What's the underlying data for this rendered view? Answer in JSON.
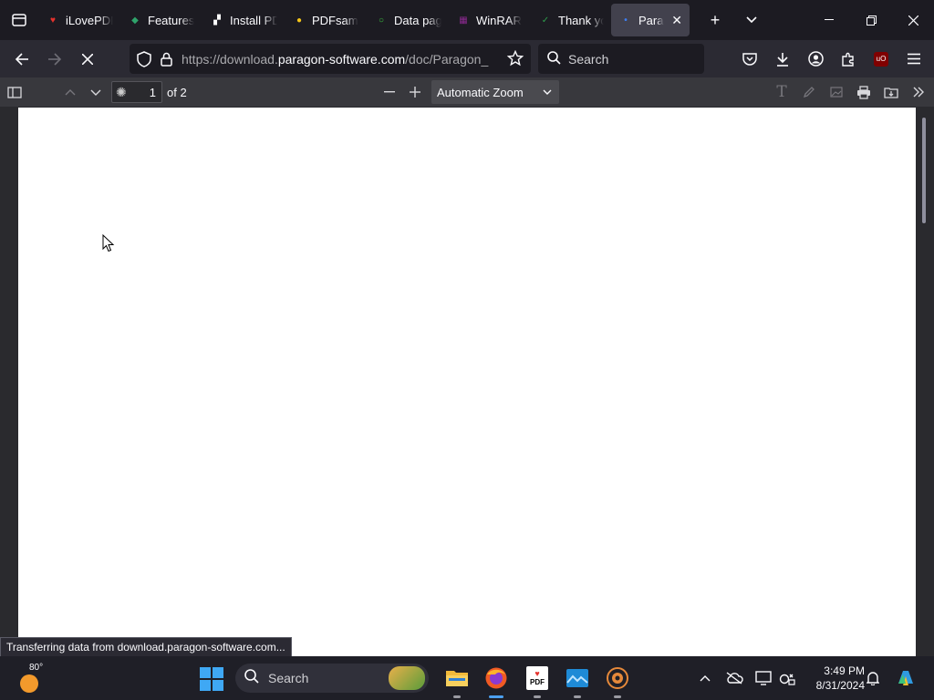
{
  "browser": {
    "tabs": [
      {
        "label": "iLovePDF",
        "favicon_color": "#e5322d",
        "favicon_glyph": "♥",
        "active": false
      },
      {
        "label": "Features",
        "favicon_color": "#2fa36b",
        "favicon_glyph": "◆",
        "active": false
      },
      {
        "label": "Install PDF",
        "favicon_color": "#ffffff",
        "favicon_glyph": "▞",
        "active": false
      },
      {
        "label": "PDFsam",
        "favicon_color": "#f5c518",
        "favicon_glyph": "●",
        "active": false
      },
      {
        "label": "Data page",
        "favicon_color": "#3cc441",
        "favicon_glyph": "○",
        "active": false
      },
      {
        "label": "WinRAR",
        "favicon_color": "#8b2a8f",
        "favicon_glyph": "▦",
        "active": false
      },
      {
        "label": "Thank you",
        "favicon_color": "#2e9d4b",
        "favicon_glyph": "✓",
        "active": false
      },
      {
        "label": "Parag",
        "favicon_color": "#3d7ef0",
        "favicon_glyph": "•",
        "active": true
      }
    ],
    "url_prefix": "https://download.",
    "url_domain": "paragon-software.com",
    "url_path": "/doc/Paragon_",
    "search_placeholder": "Search"
  },
  "pdf_toolbar": {
    "page_number": "1",
    "page_count": "of 2",
    "zoom": "Automatic Zoom"
  },
  "status": {
    "text": "Transferring data from download.paragon-software.com..."
  },
  "taskbar": {
    "weather_temp": "80°",
    "search_placeholder": "Search",
    "time": "3:49 PM",
    "date": "8/31/2024",
    "pdf_app_label": "PDF"
  }
}
